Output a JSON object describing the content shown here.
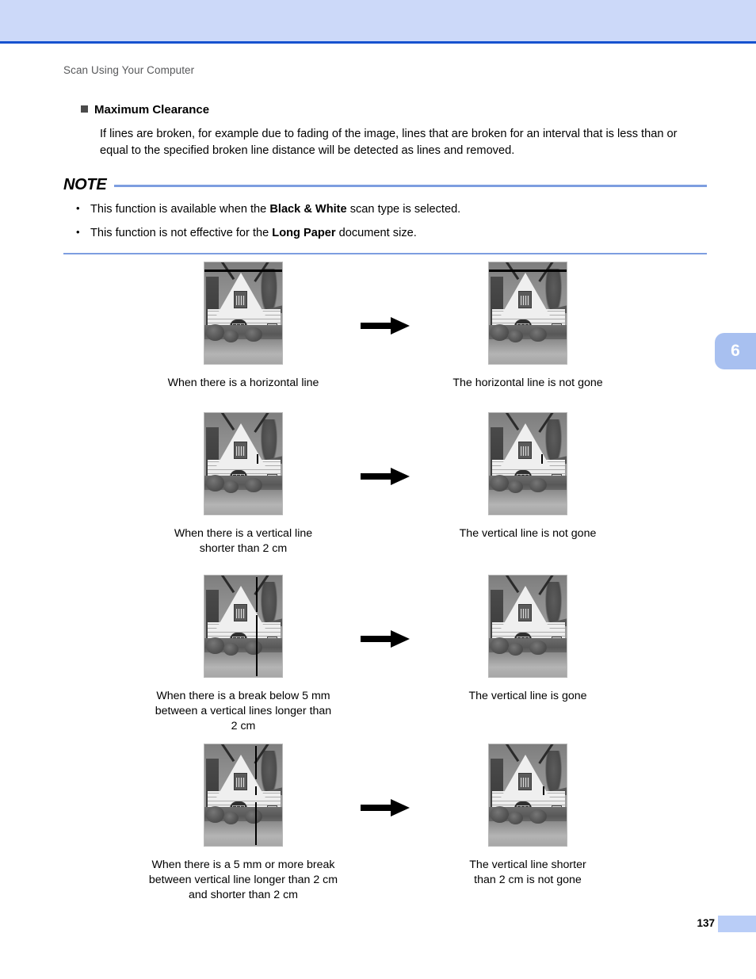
{
  "theme": {
    "band_fill": "#ccd9f9",
    "band_rule": "#1652cf",
    "note_rule": "#7d9ee0",
    "tab_fill": "#a8c0f0",
    "footer_tab_fill": "#b9cdf7",
    "header_text": "#58595b",
    "bullet_square": "#4b4b4b"
  },
  "header": {
    "running_title": "Scan Using Your Computer"
  },
  "section": {
    "heading": "Maximum Clearance",
    "body": "If lines are broken, for example due to fading of the image, lines that are broken for an interval that is less than or equal to the specified broken line distance will be detected as lines and removed."
  },
  "note": {
    "title": "NOTE",
    "items": [
      {
        "pre": "This function is available when the ",
        "bold": "Black & White",
        "post": " scan type is selected."
      },
      {
        "pre": "This function is not effective for the ",
        "bold": "Long Paper",
        "post": " document size."
      }
    ]
  },
  "figures": {
    "arrow_icon": "arrow-right-icon",
    "rows": [
      {
        "before_caption": "When there is a horizontal line",
        "after_caption": "The horizontal line is not gone",
        "before_defect": "horizontal-line",
        "after_defect": "horizontal-line"
      },
      {
        "before_caption": "When there is a vertical line\nshorter than 2 cm",
        "after_caption": "The vertical line is not gone",
        "before_defect": "short-vertical-line",
        "after_defect": "short-vertical-line"
      },
      {
        "before_caption": "When there is a break below 5 mm\nbetween a vertical lines longer than\n2 cm",
        "after_caption": "The vertical line is gone",
        "before_defect": "long-vertical-line-small-break",
        "after_defect": "none"
      },
      {
        "before_caption": "When there is a 5 mm or more break\nbetween vertical line longer than 2 cm\nand shorter than 2 cm",
        "after_caption": "The vertical line shorter\nthan 2 cm is not gone",
        "before_defect": "long-vertical-line-large-break",
        "after_defect": "short-vertical-line"
      }
    ]
  },
  "chapter_tab": {
    "number": "6"
  },
  "footer": {
    "page_number": "137"
  }
}
